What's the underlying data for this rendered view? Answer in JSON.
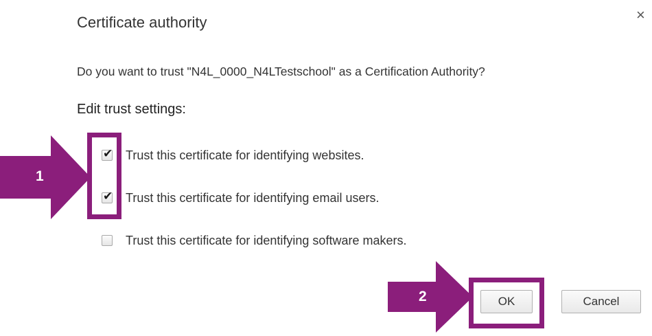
{
  "dialog": {
    "title": "Certificate authority",
    "close_icon": "×",
    "question": "Do you want to trust \"N4L_0000_N4LTestschool\" as a Certification Authority?",
    "section_heading": "Edit trust settings:",
    "options": [
      {
        "label": "Trust this certificate for identifying websites.",
        "checked": true
      },
      {
        "label": "Trust this certificate for identifying email users.",
        "checked": true
      },
      {
        "label": "Trust this certificate for identifying software makers.",
        "checked": false
      }
    ],
    "ok_label": "OK",
    "cancel_label": "Cancel"
  },
  "annotations": {
    "step1": "1",
    "step2": "2",
    "color": "#8b1e7b"
  }
}
